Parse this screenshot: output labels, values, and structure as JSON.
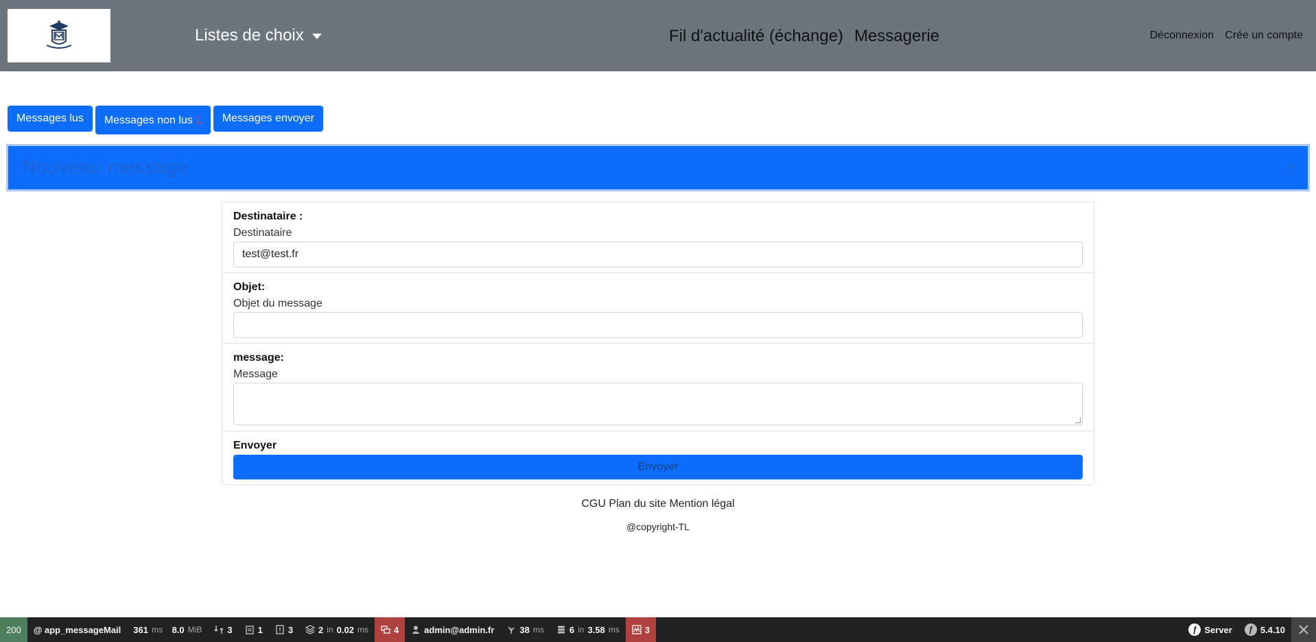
{
  "navbar": {
    "dropdown_label": "Listes de choix",
    "links": [
      "Fil d'actualité (échange)",
      "Messagerie"
    ],
    "right_links": [
      "Déconnexion",
      "Crée un compte"
    ]
  },
  "tabs": {
    "read": "Messages lus",
    "unread": "Messages non lus",
    "unread_count": "1",
    "sent": "Messages envoyer"
  },
  "accordion": {
    "title": "Nouveau message"
  },
  "form": {
    "recipient_label": "Destinataire :",
    "recipient_sub": "Destinataire",
    "recipient_value": "test@test.fr",
    "subject_label": "Objet:",
    "subject_sub": "Objet du message",
    "subject_value": "",
    "message_label": "message:",
    "message_sub": "Message",
    "message_value": "",
    "send_label": "Envoyer",
    "send_button": "Envoyer"
  },
  "footer": {
    "links": [
      "CGU",
      "Plan du site",
      "Mention légal"
    ],
    "copyright": "@copyright-TL"
  },
  "debug_toolbar": {
    "status": "200",
    "route": "@ app_messageMail",
    "time_value": "361",
    "time_unit": "ms",
    "memory_value": "8.0",
    "memory_unit": "MiB",
    "requests_count": "3",
    "forms_count": "1",
    "validator_count": "3",
    "cache_count": "2",
    "cache_in": "in",
    "cache_time": "0.02",
    "cache_unit": "ms",
    "translation_count": "4",
    "user": "admin@admin.fr",
    "twig_time": "38",
    "twig_unit": "ms",
    "db_count": "6",
    "db_in": "in",
    "db_time": "3.58",
    "db_unit": "ms",
    "logs_count": "3",
    "server": "Server",
    "version": "5.4.10"
  }
}
